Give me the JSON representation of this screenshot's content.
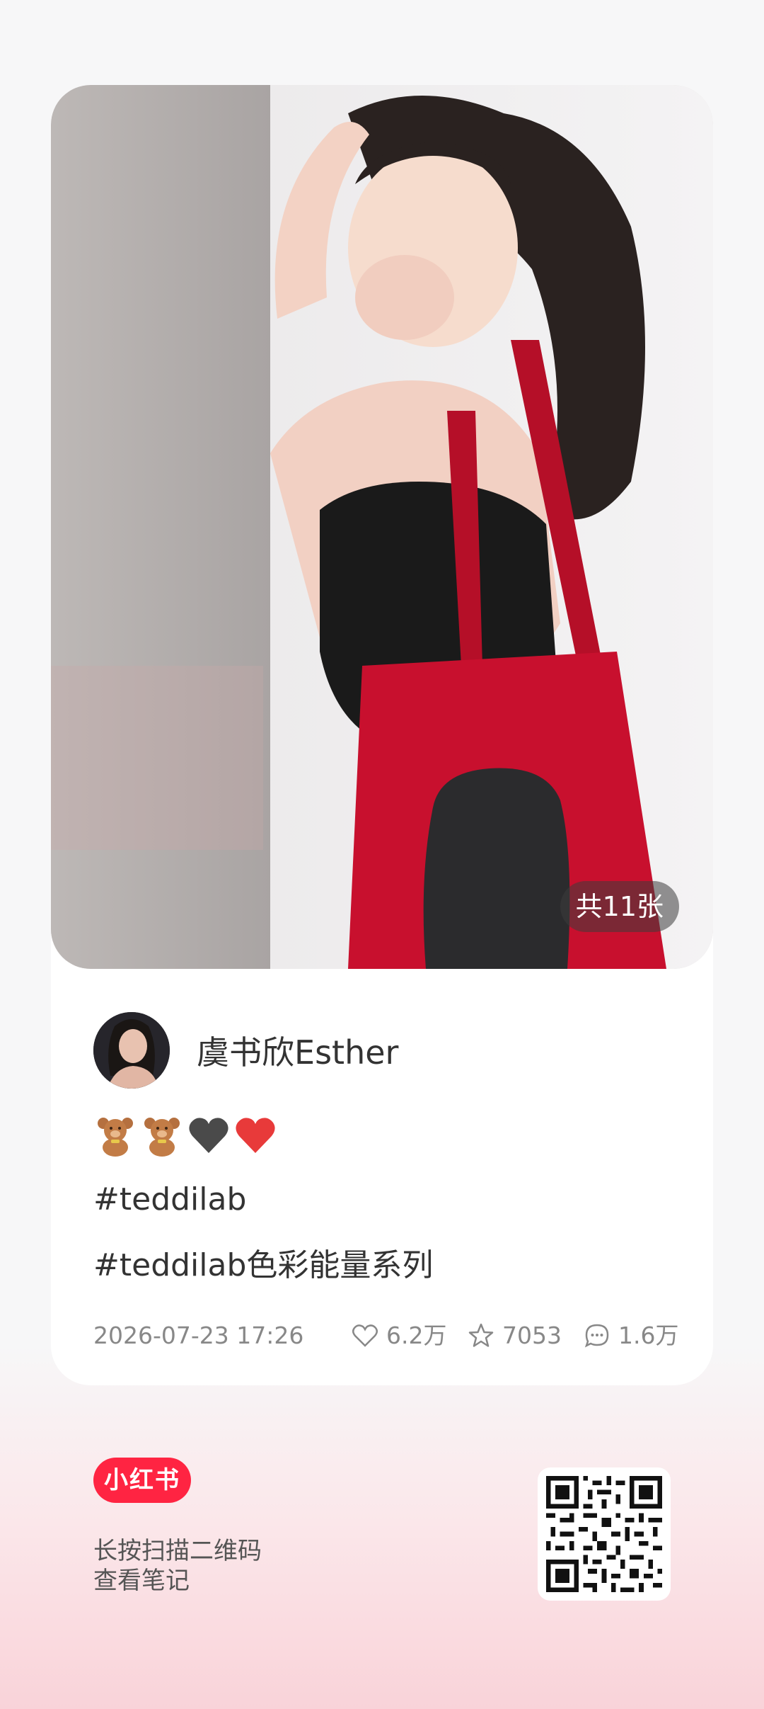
{
  "post": {
    "image_count": "共11张",
    "author": "虞书欣Esther",
    "emojis": [
      "teddy-bear",
      "teddy-bear",
      "black-heart",
      "red-heart"
    ],
    "tags": [
      "#teddilab",
      "#teddilab色彩能量系列"
    ],
    "date": "2026-07-23 17:26",
    "likes": "6.2万",
    "collects": "7053",
    "comments": "1.6万"
  },
  "footer": {
    "logo": "小红书",
    "hint_line1": "长按扫描二维码",
    "hint_line2": "查看笔记"
  },
  "colors": {
    "brand": "#ff2442",
    "bag_red": "#c8102e",
    "muted": "#888888"
  }
}
